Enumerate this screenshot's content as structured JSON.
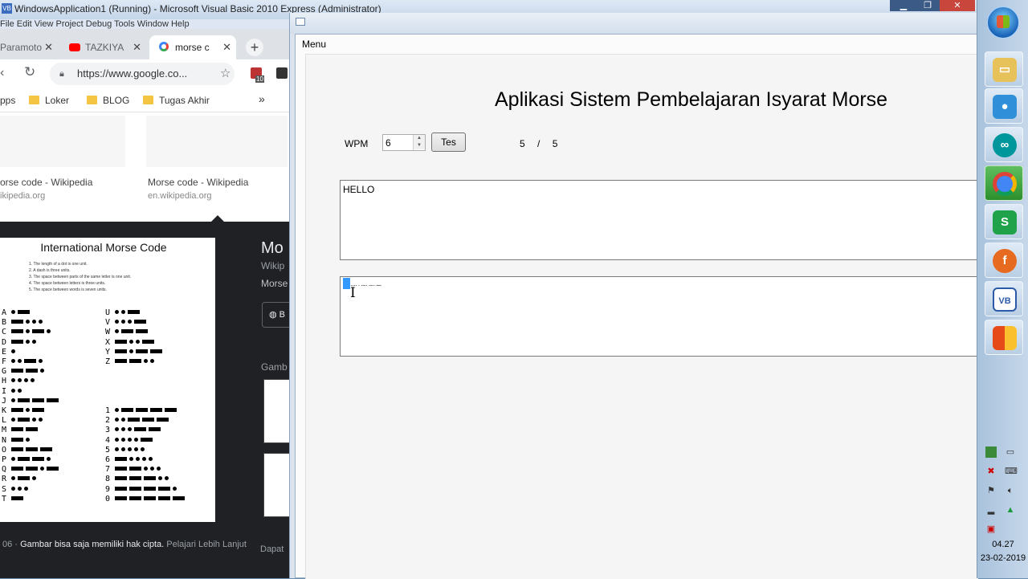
{
  "vs": {
    "title": "WindowsApplication1 (Running) - Microsoft Visual Basic 2010 Express (Administrator)",
    "icon": "VB",
    "menu": "File  Edit  View  Project  Debug  Tools  Window  Help"
  },
  "chrome": {
    "tabs": [
      {
        "label": "Paramoto",
        "icon": "page-icon"
      },
      {
        "label": "TAZKIYA",
        "icon": "youtube-icon"
      },
      {
        "label": "morse c",
        "icon": "google-icon"
      }
    ],
    "new_tab": "+",
    "url": "https://www.google.co...",
    "extension_badge": "10",
    "bookmarks": [
      {
        "label": "pps"
      },
      {
        "label": "Loker"
      },
      {
        "label": "BLOG"
      },
      {
        "label": "Tugas Akhir"
      }
    ],
    "bookmarks_more": "»",
    "results": [
      {
        "title": "orse code - Wikipedia",
        "url": "ikipedia.org"
      },
      {
        "title": "Morse code - Wikipedia",
        "url": "en.wikipedia.org"
      }
    ],
    "preview": {
      "chart_title": "International Morse Code",
      "rules": [
        "1. The length of a dot is one unit.",
        "2. A dash is three units.",
        "3. The space between parts of the same letter is one unit.",
        "4. The space between letters is three units.",
        "5. The space between words is seven units."
      ],
      "letters_left": [
        {
          "k": "A",
          "c": ".-"
        },
        {
          "k": "B",
          "c": "-..."
        },
        {
          "k": "C",
          "c": "-.-."
        },
        {
          "k": "D",
          "c": "-.."
        },
        {
          "k": "E",
          "c": "."
        },
        {
          "k": "F",
          "c": "..-."
        },
        {
          "k": "G",
          "c": "--."
        },
        {
          "k": "H",
          "c": "...."
        },
        {
          "k": "I",
          "c": ".."
        },
        {
          "k": "J",
          "c": ".---"
        },
        {
          "k": "K",
          "c": "-.-"
        },
        {
          "k": "L",
          "c": ".-.."
        },
        {
          "k": "M",
          "c": "--"
        },
        {
          "k": "N",
          "c": "-."
        },
        {
          "k": "O",
          "c": "---"
        },
        {
          "k": "P",
          "c": ".--."
        },
        {
          "k": "Q",
          "c": "--.-"
        },
        {
          "k": "R",
          "c": ".-."
        },
        {
          "k": "S",
          "c": "..."
        },
        {
          "k": "T",
          "c": "-"
        }
      ],
      "letters_right": [
        {
          "k": "U",
          "c": "..-"
        },
        {
          "k": "V",
          "c": "...-"
        },
        {
          "k": "W",
          "c": ".--"
        },
        {
          "k": "X",
          "c": "-..-"
        },
        {
          "k": "Y",
          "c": "-.--"
        },
        {
          "k": "Z",
          "c": "--.."
        }
      ],
      "digits": [
        {
          "k": "1",
          "c": ".----"
        },
        {
          "k": "2",
          "c": "..---"
        },
        {
          "k": "3",
          "c": "...--"
        },
        {
          "k": "4",
          "c": "....-"
        },
        {
          "k": "5",
          "c": "....."
        },
        {
          "k": "6",
          "c": "-...."
        },
        {
          "k": "7",
          "c": "--..."
        },
        {
          "k": "8",
          "c": "---.."
        },
        {
          "k": "9",
          "c": "----."
        },
        {
          "k": "0",
          "c": "-----"
        }
      ],
      "title": "Mo",
      "sub1": "Wikip",
      "sub2": "Morse",
      "button": "B",
      "related": "Gamb",
      "footer_prefix": "06 · ",
      "footer_bold": "Gambar bisa saja memiliki hak cipta.",
      "footer_link": "Pelajari Lebih Lanjut",
      "footer2": "Dapat"
    }
  },
  "app": {
    "menu": "Menu",
    "title": "Aplikasi Sistem Pembelajaran Isyarat Morse",
    "wpm_label": "WPM",
    "wpm_value": "6",
    "test_button": "Tes",
    "counter_current": "5",
    "counter_sep": "/",
    "counter_total": "5",
    "input_text": "HELLO",
    "output_text": "····  ·  ·-··  ·-··  ---"
  },
  "taskbar": {
    "apps": [
      "explorer-icon",
      "rec-icon",
      "arduino-icon",
      "chrome-icon",
      "spreadsheet-icon",
      "firefox-icon",
      "vb-icon",
      "office-icon"
    ],
    "time": "04.27",
    "date": "23-02-2019"
  },
  "colors": {
    "chrome_tabs": "#dee1e6",
    "preview_bg": "#202124",
    "selection": "#3399ff",
    "taskbar": "#b9cee4"
  }
}
